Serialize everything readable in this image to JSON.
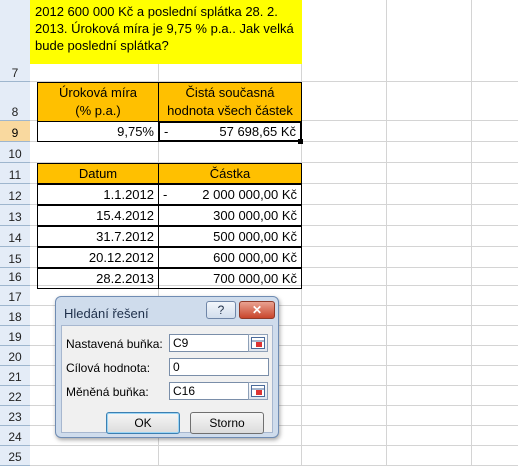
{
  "task_text": "2012 600 000 Kč a poslední splátka 28. 2. 2013. Úroková míra je 9,75 % p.a.. Jak velká bude poslední splátka?",
  "row_numbers": [
    "7",
    "8",
    "9",
    "10",
    "11",
    "12",
    "13",
    "14",
    "15",
    "16",
    "17",
    "18",
    "19",
    "20",
    "21",
    "22",
    "23",
    "24",
    "25"
  ],
  "rate_table": {
    "header_rate": "Úroková míra\n(% p.a.)",
    "header_rate_line1": "Úroková míra",
    "header_rate_line2": "(% p.a.)",
    "header_npv_line1": "Čistá současná",
    "header_npv_line2": "hodnota všech částek",
    "rate_value": "9,75%",
    "npv_sign": "-",
    "npv_value": "57 698,65 Kč"
  },
  "payments_table": {
    "header_date": "Datum",
    "header_amount": "Částka",
    "rows": [
      {
        "date": "1.1.2012",
        "sign": "-",
        "amount": "2 000 000,00 Kč"
      },
      {
        "date": "15.4.2012",
        "sign": "",
        "amount": "300 000,00 Kč"
      },
      {
        "date": "31.7.2012",
        "sign": "",
        "amount": "500 000,00 Kč"
      },
      {
        "date": "20.12.2012",
        "sign": "",
        "amount": "600 000,00 Kč"
      },
      {
        "date": "28.2.2013",
        "sign": "",
        "amount": "700 000,00 Kč"
      }
    ]
  },
  "goal_seek_dialog": {
    "title": "Hledání řešení",
    "help_label": "?",
    "close_label": "✕",
    "set_cell_label": "Nastavená buňka:",
    "set_cell_value": "C9",
    "to_value_label": "Cílová hodnota:",
    "to_value_value": "0",
    "changing_cell_label": "Měněná buňka:",
    "changing_cell_value": "C16",
    "ok_label": "OK",
    "cancel_label": "Storno"
  },
  "colors": {
    "header_orange": "#ffc000",
    "task_yellow": "#ffff00",
    "row_header_bg": "#e4ecf7",
    "row_header_selected": "#f9d99f"
  }
}
